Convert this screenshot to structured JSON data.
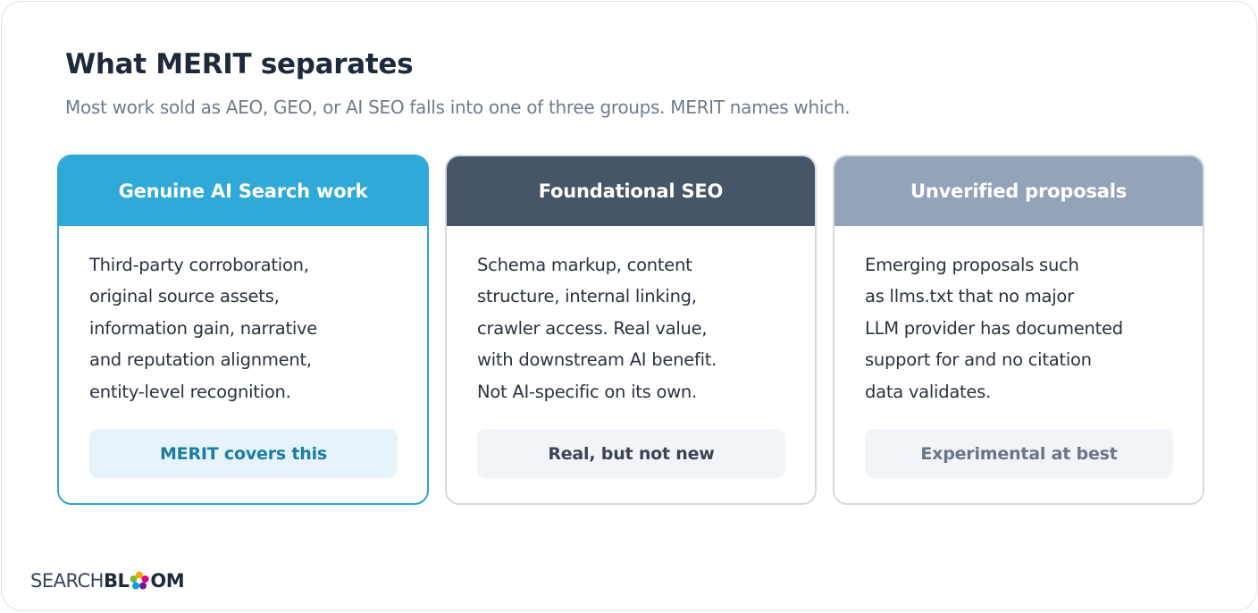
{
  "header": {
    "title": "What MERIT separates",
    "subtitle": "Most work sold as AEO, GEO, or AI SEO falls into one of three groups. MERIT names which."
  },
  "cards": [
    {
      "heading": "Genuine AI Search work",
      "lines": [
        "Third-party corroboration,",
        "original source assets,",
        "information gain, narrative",
        "and reputation alignment,",
        "entity-level recognition."
      ],
      "badge": "MERIT covers this"
    },
    {
      "heading": "Foundational SEO",
      "lines": [
        "Schema markup, content",
        "structure, internal linking,",
        "crawler access. Real value,",
        "with downstream AI benefit.",
        "Not AI-specific on its own."
      ],
      "badge": "Real, but not new"
    },
    {
      "heading": "Unverified proposals",
      "lines": [
        "Emerging proposals such",
        "as llms.txt that no major",
        "LLM provider has documented",
        "support for and no citation",
        "data validates."
      ],
      "badge": "Experimental at best"
    }
  ],
  "logo": {
    "part1": "SEARCH",
    "part2": "BL",
    "part3": "OM",
    "icon": "flower-icon"
  },
  "colors": {
    "accent": "#2ea9d8",
    "dark": "#465567",
    "muted": "#94a3b8"
  }
}
